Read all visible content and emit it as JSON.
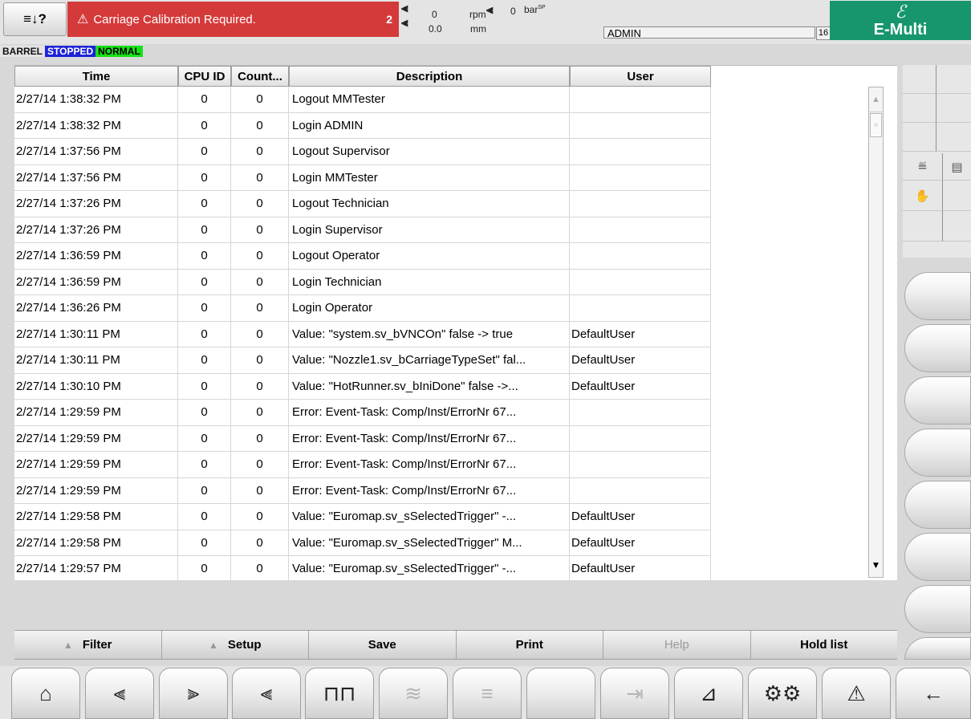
{
  "header": {
    "help_icon": "help-arrow-icon",
    "help_glyph": "≡↓?",
    "alarm_icon": "warning-triangle-icon",
    "alarm_glyph": "⚠",
    "alarm_message": "Carriage Calibration Required.",
    "alarm_count": "2",
    "speed_value": "0",
    "speed_unit": "rpm",
    "position_value": "0.0",
    "position_unit": "mm",
    "pressure_value": "0",
    "pressure_unit": "bar",
    "pressure_unit_sup": "SP",
    "user": "ADMIN",
    "user_level": "16",
    "logo_text": "E-Multi"
  },
  "status": {
    "barrel": "BARREL",
    "state": "STOPPED",
    "mode": "NORMAL",
    "colors": {
      "stopped": "#1c22d8",
      "normal": "#17e016",
      "alarm": "#d53a3b",
      "logo": "#17966d"
    }
  },
  "table": {
    "columns": [
      "Time",
      "CPU ID",
      "Count...",
      "Description",
      "User"
    ],
    "rows": [
      [
        "2/27/14 1:38:32 PM",
        "0",
        "0",
        "Logout MMTester",
        ""
      ],
      [
        "2/27/14 1:38:32 PM",
        "0",
        "0",
        "Login ADMIN",
        ""
      ],
      [
        "2/27/14 1:37:56 PM",
        "0",
        "0",
        "Logout Supervisor",
        ""
      ],
      [
        "2/27/14 1:37:56 PM",
        "0",
        "0",
        "Login MMTester",
        ""
      ],
      [
        "2/27/14 1:37:26 PM",
        "0",
        "0",
        "Logout Technician",
        ""
      ],
      [
        "2/27/14 1:37:26 PM",
        "0",
        "0",
        "Login Supervisor",
        ""
      ],
      [
        "2/27/14 1:36:59 PM",
        "0",
        "0",
        "Logout Operator",
        ""
      ],
      [
        "2/27/14 1:36:59 PM",
        "0",
        "0",
        "Login Technician",
        ""
      ],
      [
        "2/27/14 1:36:26 PM",
        "0",
        "0",
        "Login Operator",
        ""
      ],
      [
        "2/27/14 1:30:11 PM",
        "0",
        "0",
        "Value: \"system.sv_bVNCOn\" false -> true",
        "DefaultUser"
      ],
      [
        "2/27/14 1:30:11 PM",
        "0",
        "0",
        "Value: \"Nozzle1.sv_bCarriageTypeSet\" fal...",
        "DefaultUser"
      ],
      [
        "2/27/14 1:30:10 PM",
        "0",
        "0",
        "Value: \"HotRunner.sv_bIniDone\" false ->...",
        "DefaultUser"
      ],
      [
        "2/27/14 1:29:59 PM",
        "0",
        "0",
        "Error: Event-Task: Comp/Inst/ErrorNr 67...",
        ""
      ],
      [
        "2/27/14 1:29:59 PM",
        "0",
        "0",
        "Error: Event-Task: Comp/Inst/ErrorNr 67...",
        ""
      ],
      [
        "2/27/14 1:29:59 PM",
        "0",
        "0",
        "Error: Event-Task: Comp/Inst/ErrorNr 67...",
        ""
      ],
      [
        "2/27/14 1:29:59 PM",
        "0",
        "0",
        "Error: Event-Task: Comp/Inst/ErrorNr 67...",
        ""
      ],
      [
        "2/27/14 1:29:58 PM",
        "0",
        "0",
        "Value: \"Euromap.sv_sSelectedTrigger\" -...",
        "DefaultUser"
      ],
      [
        "2/27/14 1:29:58 PM",
        "0",
        "0",
        "Value: \"Euromap.sv_sSelectedTrigger\" M...",
        "DefaultUser"
      ],
      [
        "2/27/14 1:29:57 PM",
        "0",
        "0",
        "Value: \"Euromap.sv_sSelectedTrigger\" -...",
        "DefaultUser"
      ]
    ]
  },
  "softkeys": [
    {
      "label": "Filter",
      "icon": "triangle-up-icon",
      "enabled": true
    },
    {
      "label": "Setup",
      "icon": "triangle-up-icon",
      "enabled": true
    },
    {
      "label": "Save",
      "icon": "",
      "enabled": true
    },
    {
      "label": "Print",
      "icon": "",
      "enabled": true
    },
    {
      "label": "Help",
      "icon": "",
      "enabled": false
    },
    {
      "label": "Hold list",
      "icon": "",
      "enabled": true
    }
  ],
  "side_panel": {
    "icons": [
      "heater-icon",
      "list-icon",
      "hand-icon"
    ]
  },
  "nav": [
    {
      "icon": "home-icon",
      "glyph": "⌂",
      "enabled": true
    },
    {
      "icon": "mold-close-icon",
      "glyph": "⫷",
      "enabled": true
    },
    {
      "icon": "ejector-icon",
      "glyph": "⫸",
      "enabled": true
    },
    {
      "icon": "core-icon",
      "glyph": "⫷",
      "enabled": true
    },
    {
      "icon": "injection-icon",
      "glyph": "⊓⊓",
      "enabled": true
    },
    {
      "icon": "hotrunner-icon",
      "glyph": "≋",
      "enabled": false
    },
    {
      "icon": "document-icon",
      "glyph": "≡",
      "enabled": false
    },
    {
      "icon": "blank-icon",
      "glyph": "",
      "enabled": true
    },
    {
      "icon": "robot-icon",
      "glyph": "⇥",
      "enabled": false
    },
    {
      "icon": "graph-icon",
      "glyph": "⊿",
      "enabled": true
    },
    {
      "icon": "settings-gears-icon",
      "glyph": "⚙⚙",
      "enabled": true
    },
    {
      "icon": "alarm-warning-icon",
      "glyph": "⚠",
      "enabled": true
    },
    {
      "icon": "back-arrow-icon",
      "glyph": "←",
      "enabled": true
    }
  ]
}
